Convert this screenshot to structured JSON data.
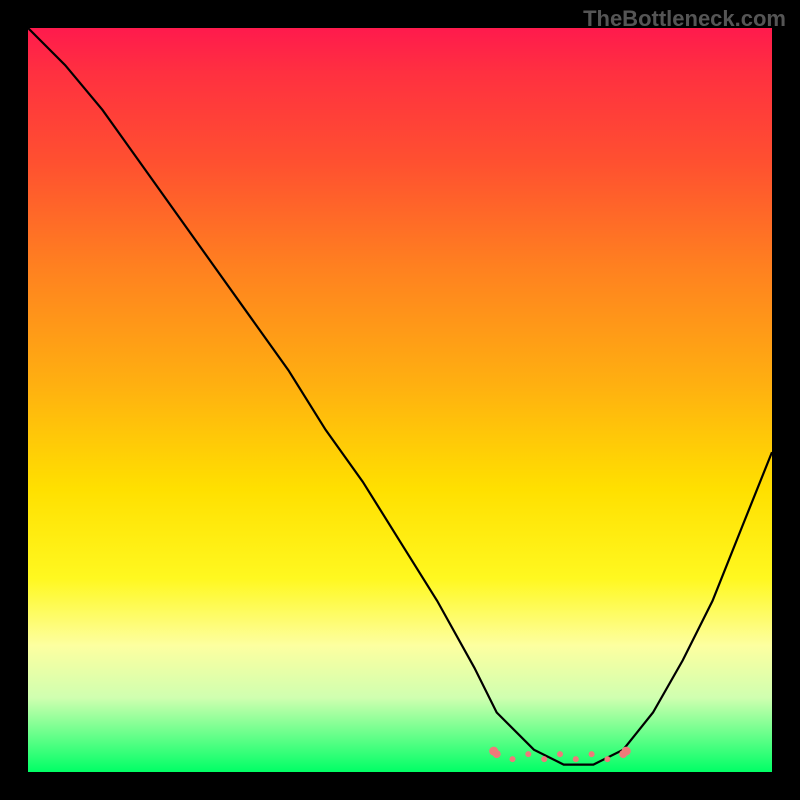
{
  "watermark": "TheBottleneck.com",
  "chart_data": {
    "type": "line",
    "title": "",
    "xlabel": "",
    "ylabel": "",
    "xlim": [
      0,
      100
    ],
    "ylim": [
      0,
      100
    ],
    "x": [
      0,
      5,
      10,
      15,
      20,
      25,
      30,
      35,
      40,
      45,
      50,
      55,
      60,
      63,
      68,
      72,
      76,
      80,
      84,
      88,
      92,
      96,
      100
    ],
    "values": [
      100,
      95,
      89,
      82,
      75,
      68,
      61,
      54,
      46,
      39,
      31,
      23,
      14,
      8,
      3,
      1,
      1,
      3,
      8,
      15,
      23,
      33,
      43
    ],
    "flat_segment": {
      "x_start": 63,
      "x_end": 80,
      "y": 2,
      "marker_color": "#ef7a7a"
    }
  },
  "colors": {
    "background": "#000000",
    "curve": "#000000",
    "marker": "#ef7a7a",
    "top_gradient": "#ff1a4d",
    "bottom_gradient": "#00ff66",
    "watermark": "#555555"
  }
}
